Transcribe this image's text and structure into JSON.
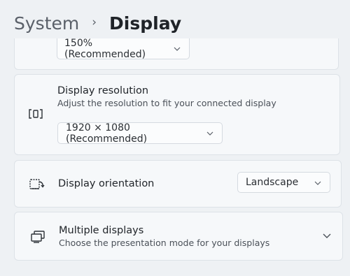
{
  "breadcrumb": {
    "parent": "System",
    "separator": "›",
    "current": "Display"
  },
  "scale": {
    "value": "150% (Recommended)",
    "chevron": "⌄"
  },
  "resolution": {
    "title": "Display resolution",
    "description": "Adjust the resolution to fit your connected display",
    "icon": "resolution-icon",
    "value": "1920 × 1080 (Recommended)",
    "chevron": "⌄"
  },
  "orientation": {
    "title": "Display orientation",
    "icon": "orientation-icon",
    "value": "Landscape",
    "chevron": "⌄"
  },
  "multiple": {
    "title": "Multiple displays",
    "description": "Choose the presentation mode for your displays",
    "icon": "multiple-displays-icon",
    "chevron": "⌄"
  }
}
